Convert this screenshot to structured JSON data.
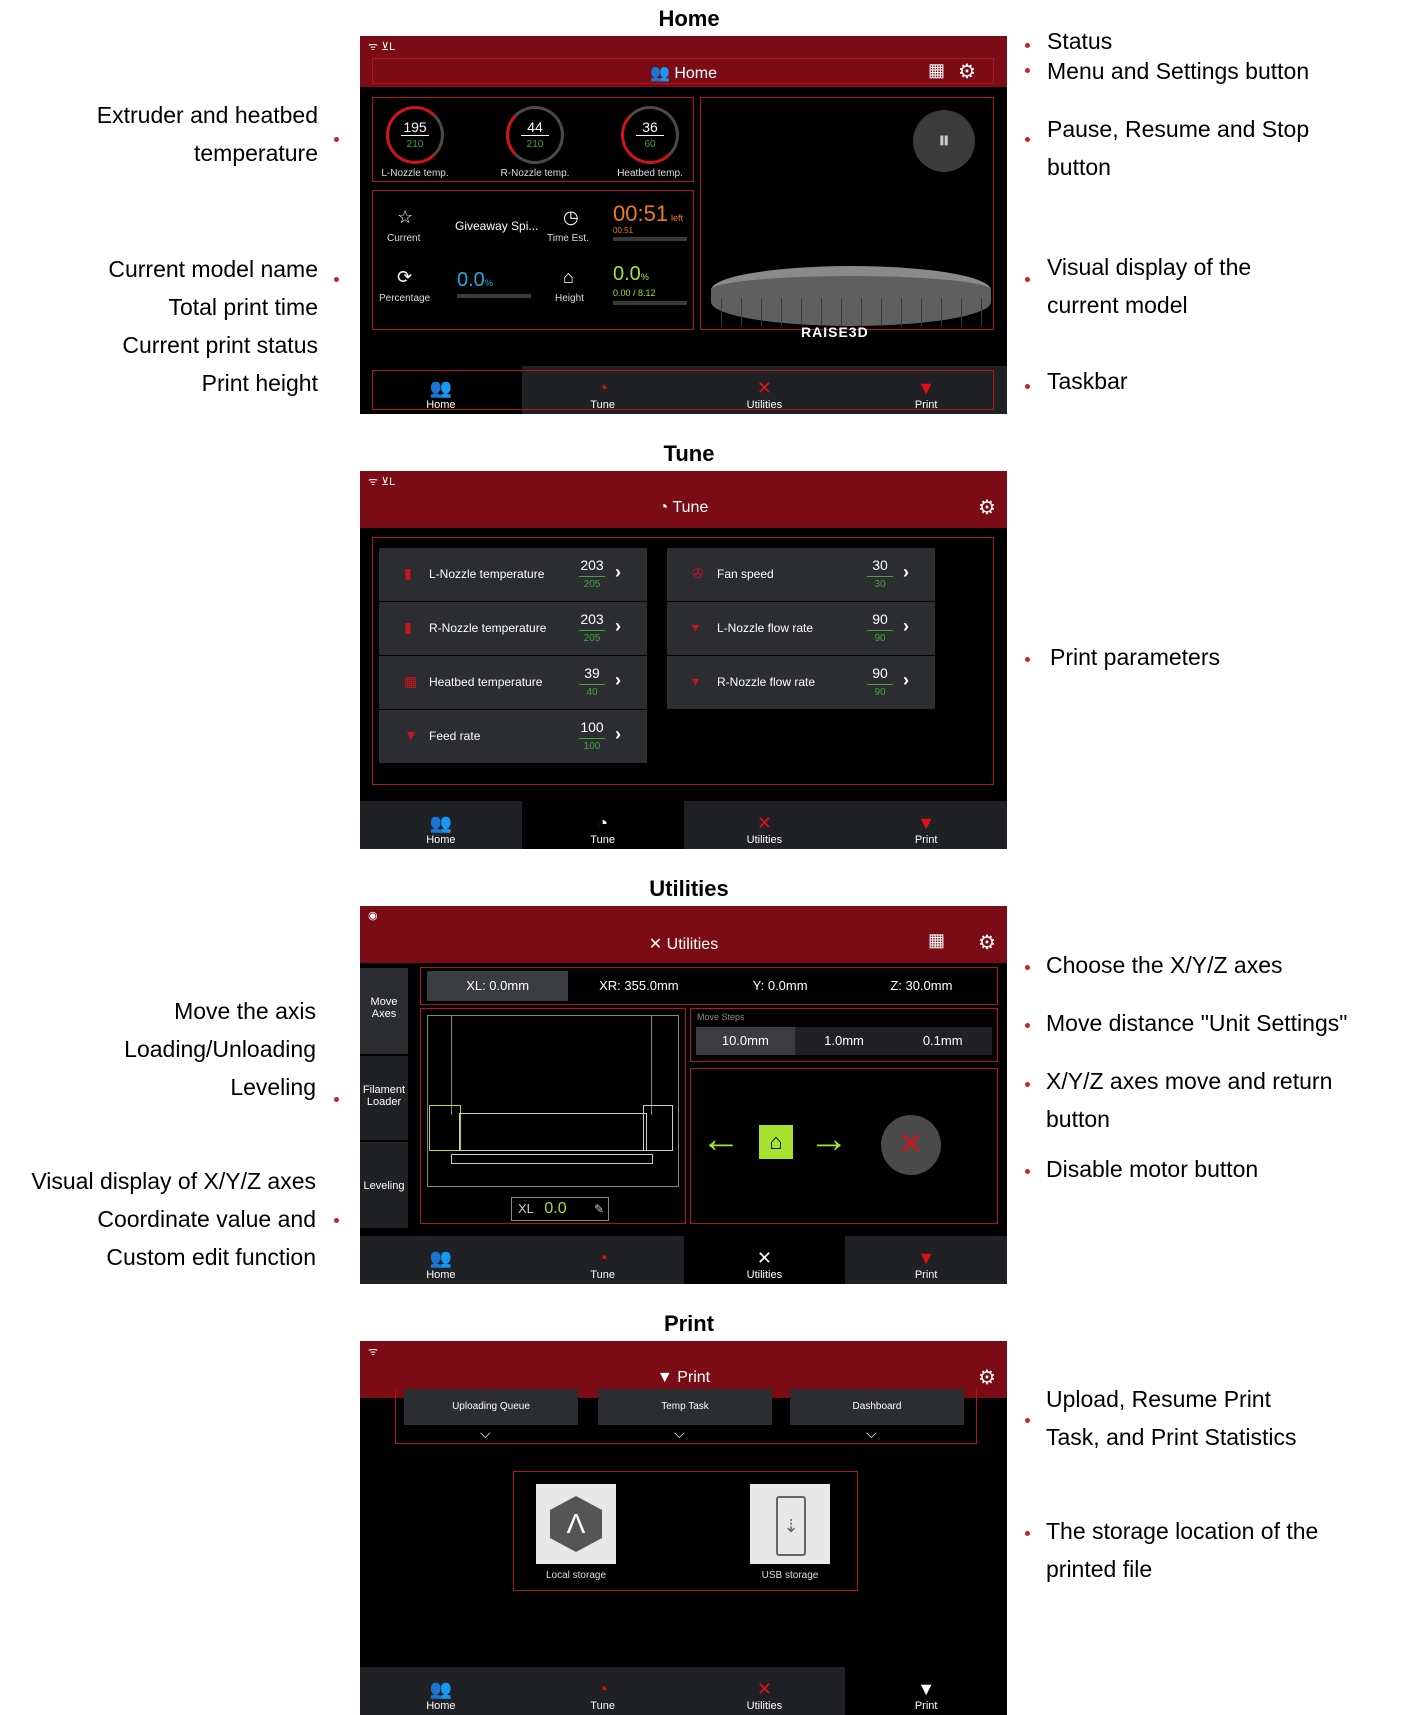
{
  "sections": {
    "home": "Home",
    "tune": "Tune",
    "utilities": "Utilities",
    "print": "Print"
  },
  "taskbar": [
    {
      "label": "Home",
      "icon": "users-icon"
    },
    {
      "label": "Tune",
      "icon": "tune-icon"
    },
    {
      "label": "Utilities",
      "icon": "tools-icon"
    },
    {
      "label": "Print",
      "icon": "print-icon"
    }
  ],
  "home": {
    "header_title": "Home",
    "status_icons": "ᯤ ⊻L",
    "gauges": [
      {
        "current": "195",
        "target": "210",
        "label": "L-Nozzle temp."
      },
      {
        "current": "44",
        "target": "210",
        "label": "R-Nozzle temp."
      },
      {
        "current": "36",
        "target": "60",
        "label": "Heatbed temp."
      }
    ],
    "info": {
      "current_label": "Current",
      "model_name": "Giveaway Spi...",
      "time_label": "Time Est.",
      "time_value": "00:51",
      "time_suffix": "left",
      "time_small": "00:51",
      "percentage_label": "Percentage",
      "percentage_value": "0.0",
      "percentage_unit": "%",
      "height_label": "Height",
      "height_value": "0.0",
      "height_unit": "%",
      "height_small": "0.00 / 8.12"
    },
    "brand": "RAISE3D"
  },
  "tune": {
    "header_title": "Tune",
    "left_rows": [
      {
        "name": "L-Nozzle temperature",
        "current": "203",
        "target": "205"
      },
      {
        "name": "R-Nozzle temperature",
        "current": "203",
        "target": "205"
      },
      {
        "name": "Heatbed temperature",
        "current": "39",
        "target": "40"
      },
      {
        "name": "Feed rate",
        "current": "100",
        "target": "100"
      }
    ],
    "right_rows": [
      {
        "name": "Fan speed",
        "current": "30",
        "target": "30"
      },
      {
        "name": "L-Nozzle flow rate",
        "current": "90",
        "target": "90"
      },
      {
        "name": "R-Nozzle flow rate",
        "current": "90",
        "target": "90"
      }
    ]
  },
  "utilities": {
    "header_title": "Utilities",
    "side_tabs": [
      "Move Axes",
      "Filament Loader",
      "Leveling"
    ],
    "axes": [
      "XL: 0.0mm",
      "XR: 355.0mm",
      "Y: 0.0mm",
      "Z: 30.0mm"
    ],
    "move_steps_label": "Move Steps",
    "steps": [
      "10.0mm",
      "1.0mm",
      "0.1mm"
    ],
    "coord_axis": "XL",
    "coord_value": "0.0"
  },
  "print": {
    "header_title": "Print",
    "tabs": [
      "Uploading Queue",
      "Temp Task",
      "Dashboard"
    ],
    "storage": [
      {
        "label": "Local storage"
      },
      {
        "label": "USB storage"
      }
    ]
  },
  "annotations": {
    "extruder": "Extruder and heatbed\ntemperature",
    "model": "Current model name\nTotal print time\nCurrent print status\nPrint height",
    "status": "Status",
    "menu": "Menu and Settings button",
    "pause": "Pause, Resume and Stop\nbutton",
    "visual": "Visual display of the\ncurrent model",
    "taskbar": "Taskbar",
    "params": "Print parameters",
    "move_axis": "Move the axis\nLoading/Unloading\nLeveling",
    "visual_axes": "Visual display of X/Y/Z axes\nCoordinate value and\nCustom edit function",
    "choose_axes": "Choose the X/Y/Z axes",
    "move_distance": "Move distance \"Unit Settings\"",
    "move_return": "X/Y/Z axes move and return\nbutton",
    "disable_motor": "Disable motor button",
    "upload": "Upload, Resume Print\nTask, and Print Statistics",
    "storage": "The storage location of the\nprinted file"
  }
}
